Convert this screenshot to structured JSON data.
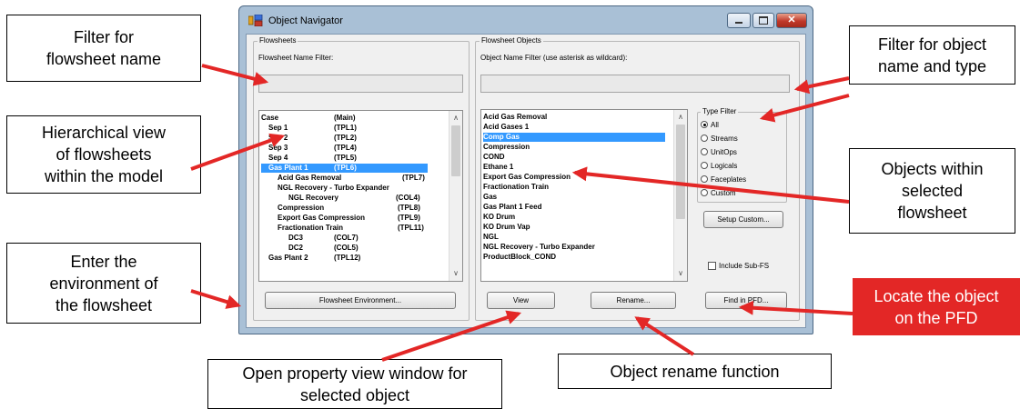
{
  "window": {
    "title": "Object Navigator",
    "icon": "object-navigator-icon"
  },
  "flowsheets": {
    "group_title": "Flowsheets",
    "filter_label": "Flowsheet Name Filter:",
    "filter_value": "",
    "items": [
      {
        "name": "Case",
        "tag": "(Main)",
        "selected": false
      },
      {
        "name": "Sep 1",
        "tag": "(TPL1)",
        "selected": false
      },
      {
        "name": "Sep 2",
        "tag": "(TPL2)",
        "selected": false
      },
      {
        "name": "Sep 3",
        "tag": "(TPL4)",
        "selected": false
      },
      {
        "name": "Sep 4",
        "tag": "(TPL5)",
        "selected": false
      },
      {
        "name": "Gas Plant 1",
        "tag": "(TPL6)",
        "selected": true
      },
      {
        "name": "Acid Gas Removal",
        "tag": "(TPL7)",
        "selected": false
      },
      {
        "name": "NGL Recovery - Turbo Expander",
        "tag": "",
        "selected": false
      },
      {
        "name": "NGL Recovery",
        "tag": "(COL4)",
        "selected": false
      },
      {
        "name": "Compression",
        "tag": "(TPL8)",
        "selected": false
      },
      {
        "name": "Export Gas Compression",
        "tag": "(TPL9)",
        "selected": false
      },
      {
        "name": "Fractionation Train",
        "tag": "(TPL11)",
        "selected": false
      },
      {
        "name": "DC3",
        "tag": "(COL7)",
        "selected": false
      },
      {
        "name": "DC2",
        "tag": "(COL5)",
        "selected": false
      },
      {
        "name": "Gas Plant 2",
        "tag": "(TPL12)",
        "selected": false
      }
    ],
    "env_button": "Flowsheet Environment..."
  },
  "objects": {
    "group_title": "Flowsheet Objects",
    "filter_label": "Object Name Filter (use asterisk as wildcard):",
    "filter_value": "",
    "items": [
      {
        "name": "Acid Gas Removal",
        "selected": false
      },
      {
        "name": "Acid Gases 1",
        "selected": false
      },
      {
        "name": "Comp Gas",
        "selected": true
      },
      {
        "name": "Compression",
        "selected": false
      },
      {
        "name": "COND",
        "selected": false
      },
      {
        "name": "Ethane 1",
        "selected": false
      },
      {
        "name": "Export Gas Compression",
        "selected": false
      },
      {
        "name": "Fractionation Train",
        "selected": false
      },
      {
        "name": "Gas",
        "selected": false
      },
      {
        "name": "Gas Plant 1 Feed",
        "selected": false
      },
      {
        "name": "KO Drum",
        "selected": false
      },
      {
        "name": "KO Drum Vap",
        "selected": false
      },
      {
        "name": "NGL",
        "selected": false
      },
      {
        "name": "NGL Recovery - Turbo Expander",
        "selected": false
      },
      {
        "name": "ProductBlock_COND",
        "selected": false
      }
    ],
    "view_button": "View",
    "rename_button": "Rename..."
  },
  "type_filter": {
    "title": "Type Filter",
    "options": [
      {
        "label": "All",
        "checked": true
      },
      {
        "label": "Streams",
        "checked": false
      },
      {
        "label": "UnitOps",
        "checked": false
      },
      {
        "label": "Logicals",
        "checked": false
      },
      {
        "label": "Faceplates",
        "checked": false
      },
      {
        "label": "Custom",
        "checked": false
      }
    ],
    "setup_button": "Setup Custom...",
    "include_subfs_label": "Include Sub-FS",
    "include_subfs_checked": false,
    "find_button": "Find in PFD..."
  },
  "callouts": {
    "filter_flowsheet": "Filter for\nflowsheet  name",
    "hierarchical": "Hierarchical view\nof flowsheets\nwithin the model",
    "enter_env": "Enter the\nenvironment of\nthe flowsheet",
    "filter_object": "Filter for object\nname and type",
    "objects_within": "Objects within\nselected\nflowsheet",
    "locate": "Locate the object\non the PFD",
    "property_view": "Open property view window for\nselected object",
    "rename": "Object rename function"
  },
  "colors": {
    "selection": "#3399ff",
    "arrow": "#e32726",
    "locate_bg": "#e32726",
    "window_frame": "#a9c0d6"
  }
}
